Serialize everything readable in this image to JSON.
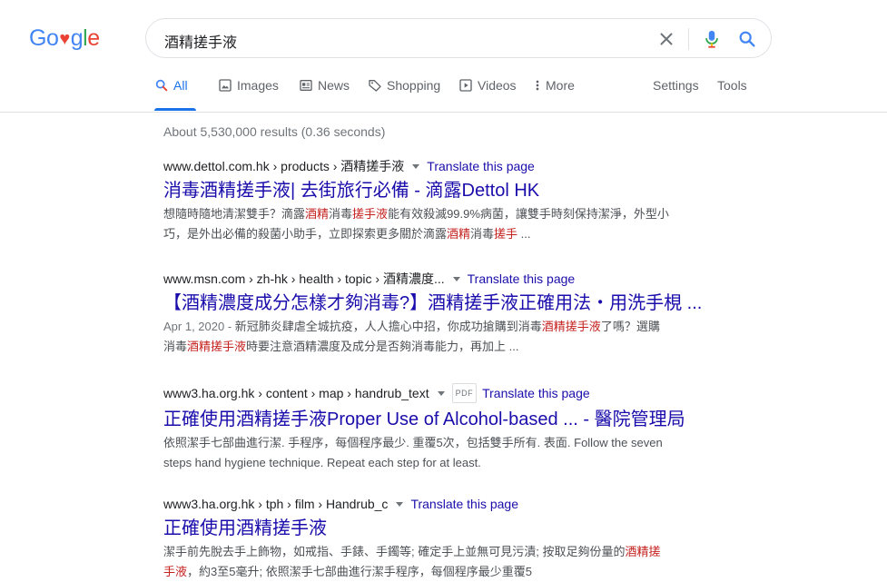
{
  "logo": {
    "part1": "Go",
    "heart": "♥",
    "part2": "gle"
  },
  "search": {
    "query": "酒精搓手液"
  },
  "tabs": [
    {
      "label": "All"
    },
    {
      "label": "Images"
    },
    {
      "label": "News"
    },
    {
      "label": "Shopping"
    },
    {
      "label": "Videos"
    },
    {
      "label": "More"
    }
  ],
  "tools": {
    "settings": "Settings",
    "tools": "Tools"
  },
  "stats": "About 5,530,000 results (0.36 seconds)",
  "results": [
    {
      "cite": "www.dettol.com.hk › products › 酒精搓手液",
      "translate": "Translate this page",
      "title": "消毒酒精搓手液| 去街旅行必備 - 滴露Dettol HK",
      "s1": "想隨時隨地清潔雙手？滴露",
      "s2": "酒精",
      "s3": "消毒",
      "s4": "搓手液",
      "s5": "能有效殺滅99.9%病菌，讓雙手時刻保持潔淨，外型小",
      "s6": "巧，是外出必備的殺菌小助手，立即探索更多關於滴露",
      "s7": "酒精",
      "s8": "消毒",
      "s9": "搓手",
      "s10": " ..."
    },
    {
      "cite": "www.msn.com › zh-hk › health › topic › 酒精濃度...",
      "translate": "Translate this page",
      "title": "【酒精濃度成分怎樣才夠消毒?】酒精搓手液正確用法・用洗手梘 ...",
      "date": "Apr 1, 2020 - ",
      "s1": "新冠肺炎肆虐全城抗疫，人人擔心中招，你成功搶購到消毒",
      "s2": "酒精搓手液",
      "s3": "了嗎？選購",
      "s4": "消毒",
      "s5": "酒精搓手液",
      "s6": "時要注意酒精濃度及成分是否夠消毒能力，再加上 ..."
    },
    {
      "cite": "www3.ha.org.hk › content › map › handrub_text",
      "pdf": "PDF",
      "translate": "Translate this page",
      "title": "正確使用酒精搓手液Proper Use of Alcohol-based ... - 醫院管理局",
      "s1": "依照潔手七部曲進行潔. 手程序，每個程序最少. 重覆5次，包括雙手所有. 表面. Follow the seven",
      "s2": "steps hand hygiene technique. Repeat each step for at least."
    },
    {
      "cite": "www3.ha.org.hk › tph › film › Handrub_c",
      "translate": "Translate this page",
      "title": "正確使用酒精搓手液",
      "s1": "潔手前先脫去手上飾物，如戒指、手錶、手鐲等; 確定手上並無可見污漬; 按取足夠份量的",
      "s2": "酒精搓",
      "s3": "手液",
      "s4": "，約3至5毫升; 依照潔手七部曲進行潔手程序，每個程序最少重覆5"
    }
  ]
}
